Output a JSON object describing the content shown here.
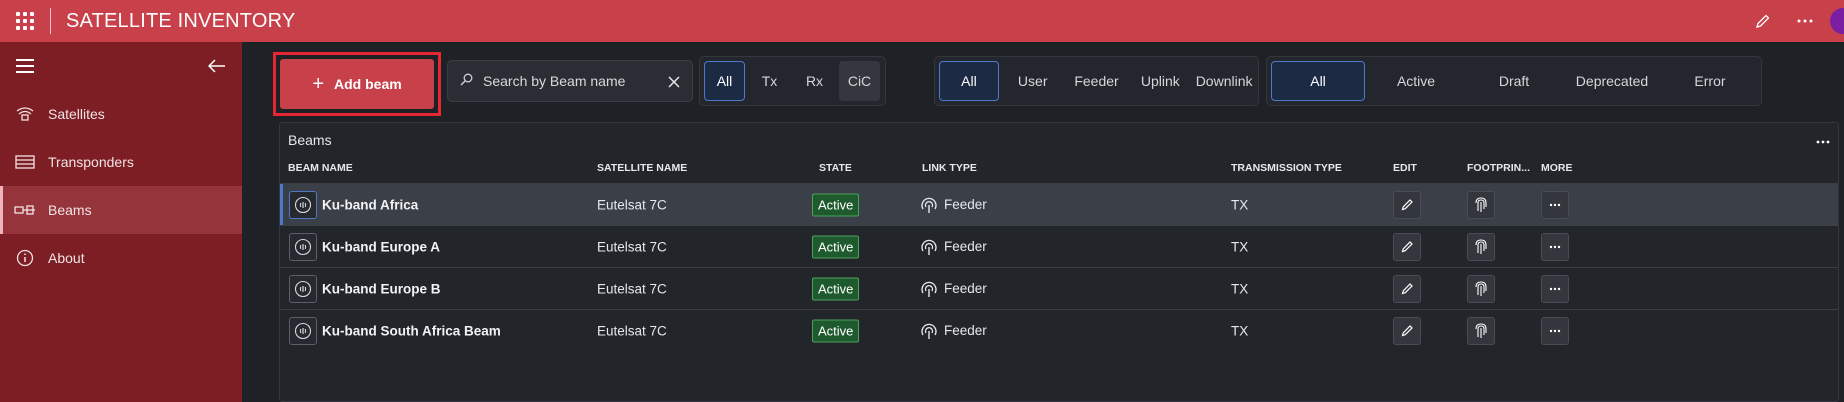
{
  "app": {
    "title": "SATELLITE INVENTORY"
  },
  "sidebar": {
    "items": [
      {
        "label": "Satellites",
        "icon": "satellite-icon"
      },
      {
        "label": "Transponders",
        "icon": "transponder-icon"
      },
      {
        "label": "Beams",
        "icon": "beam-icon",
        "active": true
      },
      {
        "label": "About",
        "icon": "info-icon"
      }
    ]
  },
  "toolbar": {
    "add_label": "Add beam",
    "search_placeholder": "Search by Beam name",
    "direction_filters": [
      "All",
      "Tx",
      "Rx",
      "CiC"
    ],
    "link_filters": [
      "All",
      "User",
      "Feeder",
      "Uplink",
      "Downlink"
    ],
    "state_filters": [
      "All",
      "Active",
      "Draft",
      "Deprecated",
      "Error"
    ]
  },
  "grid": {
    "title": "Beams",
    "columns": [
      "BEAM NAME",
      "SATELLITE NAME",
      "STATE",
      "LINK TYPE",
      "TRANSMISSION TYPE",
      "EDIT",
      "FOOTPRIN...",
      "MORE"
    ],
    "rows": [
      {
        "beam": "Ku-band Africa",
        "satellite": "Eutelsat 7C",
        "state": "Active",
        "link": "Feeder",
        "transmission": "TX",
        "selected": true
      },
      {
        "beam": "Ku-band Europe A",
        "satellite": "Eutelsat 7C",
        "state": "Active",
        "link": "Feeder",
        "transmission": "TX"
      },
      {
        "beam": "Ku-band Europe B",
        "satellite": "Eutelsat 7C",
        "state": "Active",
        "link": "Feeder",
        "transmission": "TX"
      },
      {
        "beam": "Ku-band South Africa Beam",
        "satellite": "Eutelsat 7C",
        "state": "Active",
        "link": "Feeder",
        "transmission": "TX"
      }
    ]
  },
  "colors": {
    "brand": "#c8404a",
    "sidebar": "#7c1e24",
    "selected_accent": "#4f79c7",
    "state_active": "#1f5a2e"
  }
}
